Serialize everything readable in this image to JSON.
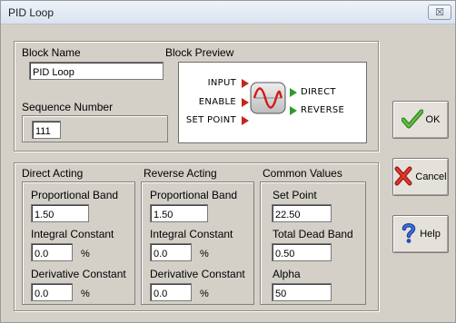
{
  "window": {
    "title": "PID Loop",
    "close_glyph": "☒"
  },
  "block_name": {
    "label": "Block Name",
    "value": "PID Loop"
  },
  "sequence_number": {
    "label": "Sequence Number",
    "value": "111"
  },
  "block_preview": {
    "label": "Block Preview",
    "inputs": [
      "INPUT",
      "ENABLE",
      "SET POINT"
    ],
    "outputs": [
      "DIRECT",
      "REVERSE"
    ],
    "icon": "pid-waveform-icon"
  },
  "direct_acting": {
    "title": "Direct Acting",
    "proportional_band_label": "Proportional Band",
    "proportional_band": "1.50",
    "integral_constant_label": "Integral Constant",
    "integral_constant": "0.0",
    "derivative_constant_label": "Derivative Constant",
    "derivative_constant": "0.0",
    "unit": "%"
  },
  "reverse_acting": {
    "title": "Reverse Acting",
    "proportional_band_label": "Proportional Band",
    "proportional_band": "1.50",
    "integral_constant_label": "Integral Constant",
    "integral_constant": "0.0",
    "derivative_constant_label": "Derivative Constant",
    "derivative_constant": "0.0",
    "unit": "%"
  },
  "common_values": {
    "title": "Common Values",
    "set_point_label": "Set Point",
    "set_point": "22.50",
    "total_dead_band_label": "Total Dead Band",
    "total_dead_band": "0.50",
    "alpha_label": "Alpha",
    "alpha": "50"
  },
  "buttons": {
    "ok": "OK",
    "cancel": "Cancel",
    "help": "Help"
  },
  "colors": {
    "input_arrow": "#c0281c",
    "output_arrow": "#2f9b2f",
    "ok_check": "#3f9a2a",
    "cancel_x": "#c0281c",
    "help_q": "#1f4fbf"
  }
}
